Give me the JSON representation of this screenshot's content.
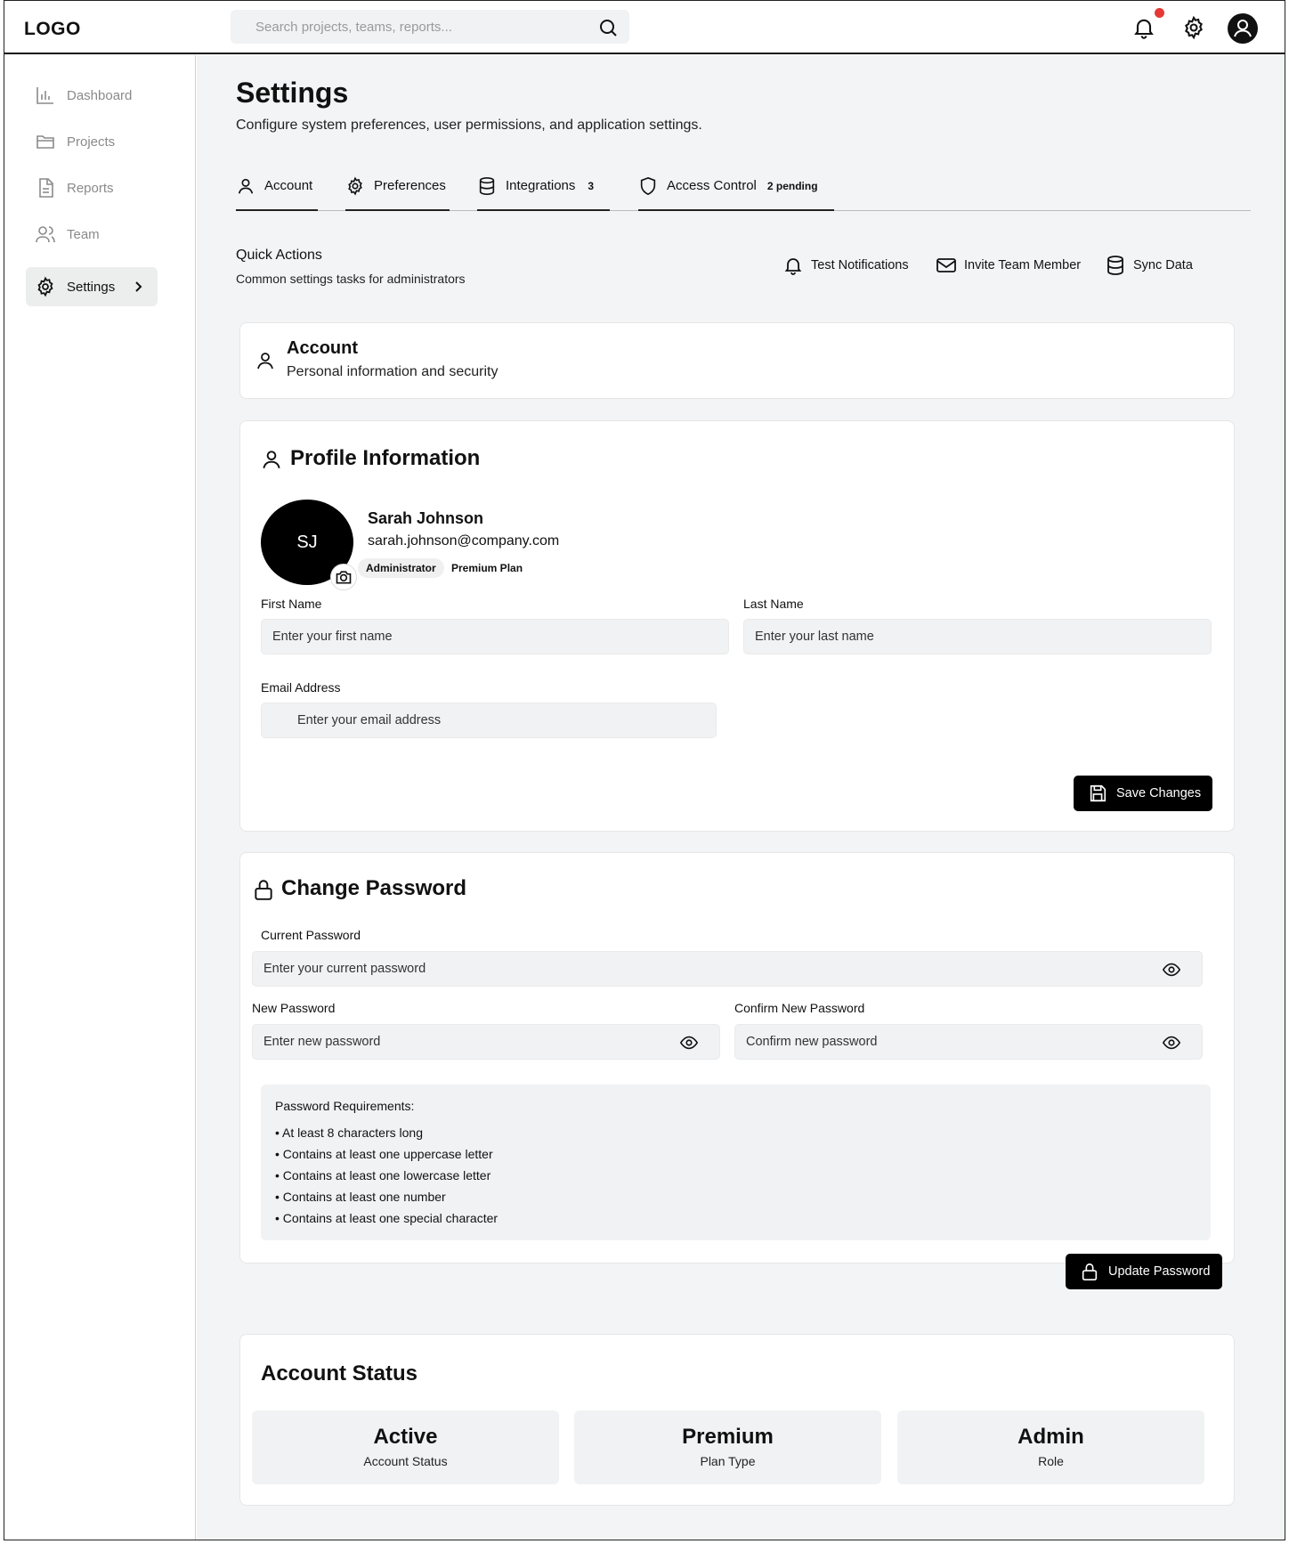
{
  "header": {
    "logo": "LOGO",
    "search_placeholder": "Search projects, teams, reports...",
    "icons": [
      "search-icon",
      "bell-icon",
      "gear-icon",
      "user-avatar-icon"
    ],
    "notification_dot_color": "#e53935"
  },
  "sidebar": {
    "items": [
      {
        "label": "Dashboard",
        "icon": "bar-chart-icon"
      },
      {
        "label": "Projects",
        "icon": "folder-icon"
      },
      {
        "label": "Reports",
        "icon": "document-icon"
      },
      {
        "label": "Team",
        "icon": "users-icon"
      },
      {
        "label": "Settings",
        "icon": "gear-icon",
        "active": true
      }
    ]
  },
  "page": {
    "title": "Settings",
    "subtitle": "Configure system preferences, user permissions, and application settings."
  },
  "tabs": [
    {
      "label": "Account",
      "icon": "user-icon",
      "badge": ""
    },
    {
      "label": "Preferences",
      "icon": "gear-icon",
      "badge": ""
    },
    {
      "label": "Integrations",
      "icon": "database-icon",
      "badge": "3"
    },
    {
      "label": "Access Control",
      "icon": "shield-icon",
      "badge": "2 pending"
    }
  ],
  "quick_actions": {
    "title": "Quick Actions",
    "subtitle": "Common settings tasks for administrators",
    "buttons": [
      {
        "label": "Test Notifications",
        "icon": "bell-icon"
      },
      {
        "label": "Invite Team Member",
        "icon": "mail-icon"
      },
      {
        "label": "Sync Data",
        "icon": "database-icon"
      }
    ]
  },
  "account_section": {
    "title": "Account",
    "subtitle": "Personal information and security"
  },
  "profile": {
    "title": "Profile Information",
    "initials": "SJ",
    "name": "Sarah Johnson",
    "email": "sarah.johnson@company.com",
    "role_badge": "Administrator",
    "plan_badge": "Premium Plan",
    "first_name_label": "First Name",
    "first_name_placeholder": "Enter your first name",
    "last_name_label": "Last Name",
    "last_name_placeholder": "Enter your last name",
    "email_label": "Email Address",
    "email_placeholder": "Enter your email address",
    "save_label": "Save Changes"
  },
  "password": {
    "title": "Change Password",
    "current_label": "Current Password",
    "current_placeholder": "Enter your current password",
    "new_label": "New Password",
    "new_placeholder": "Enter new password",
    "confirm_label": "Confirm New Password",
    "confirm_placeholder": "Confirm new password",
    "requirements_title": "Password Requirements:",
    "requirements": [
      "• At least 8 characters long",
      "• Contains at least one uppercase letter",
      "• Contains at least one lowercase letter",
      "• Contains at least one number",
      "• Contains at least one special character"
    ],
    "update_label": "Update Password"
  },
  "account_status": {
    "title": "Account Status",
    "stats": [
      {
        "value": "Active",
        "label": "Account Status"
      },
      {
        "value": "Premium",
        "label": "Plan Type"
      },
      {
        "value": "Admin",
        "label": "Role"
      }
    ]
  }
}
